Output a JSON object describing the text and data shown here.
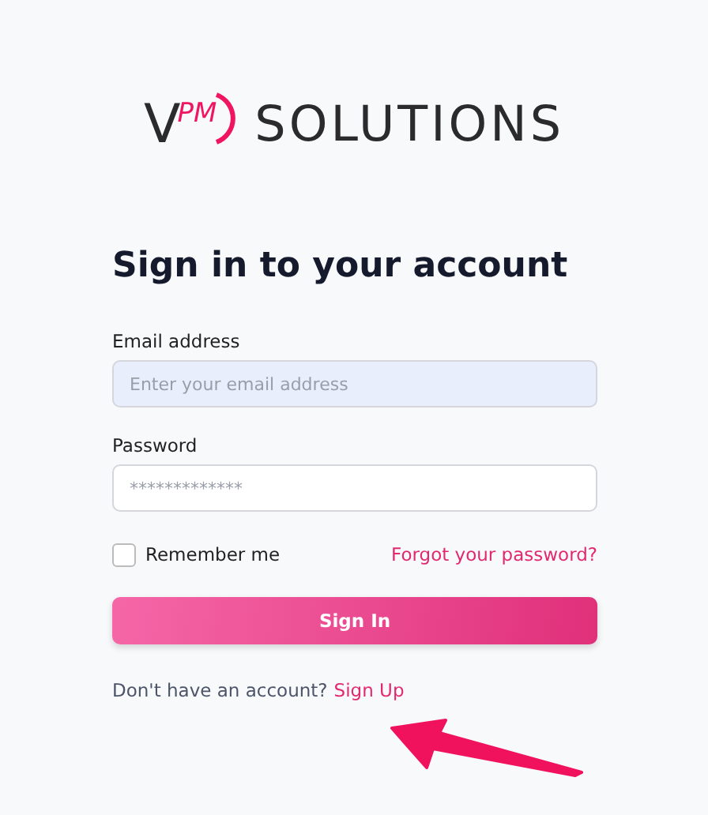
{
  "logo": {
    "letter": "V",
    "mark": "PM",
    "name": "SOLUTIONS"
  },
  "heading": "Sign in to your account",
  "fields": [
    {
      "label": "Email address",
      "placeholder": "Enter your email address",
      "focused": true
    },
    {
      "label": "Password",
      "placeholder": "*************",
      "focused": false
    }
  ],
  "remember": {
    "label": "Remember me",
    "checked": false
  },
  "forgot_link": "Forgot your password?",
  "submit": "Sign In",
  "signup": {
    "prompt": "Don't have an account?",
    "link": "Sign Up"
  }
}
